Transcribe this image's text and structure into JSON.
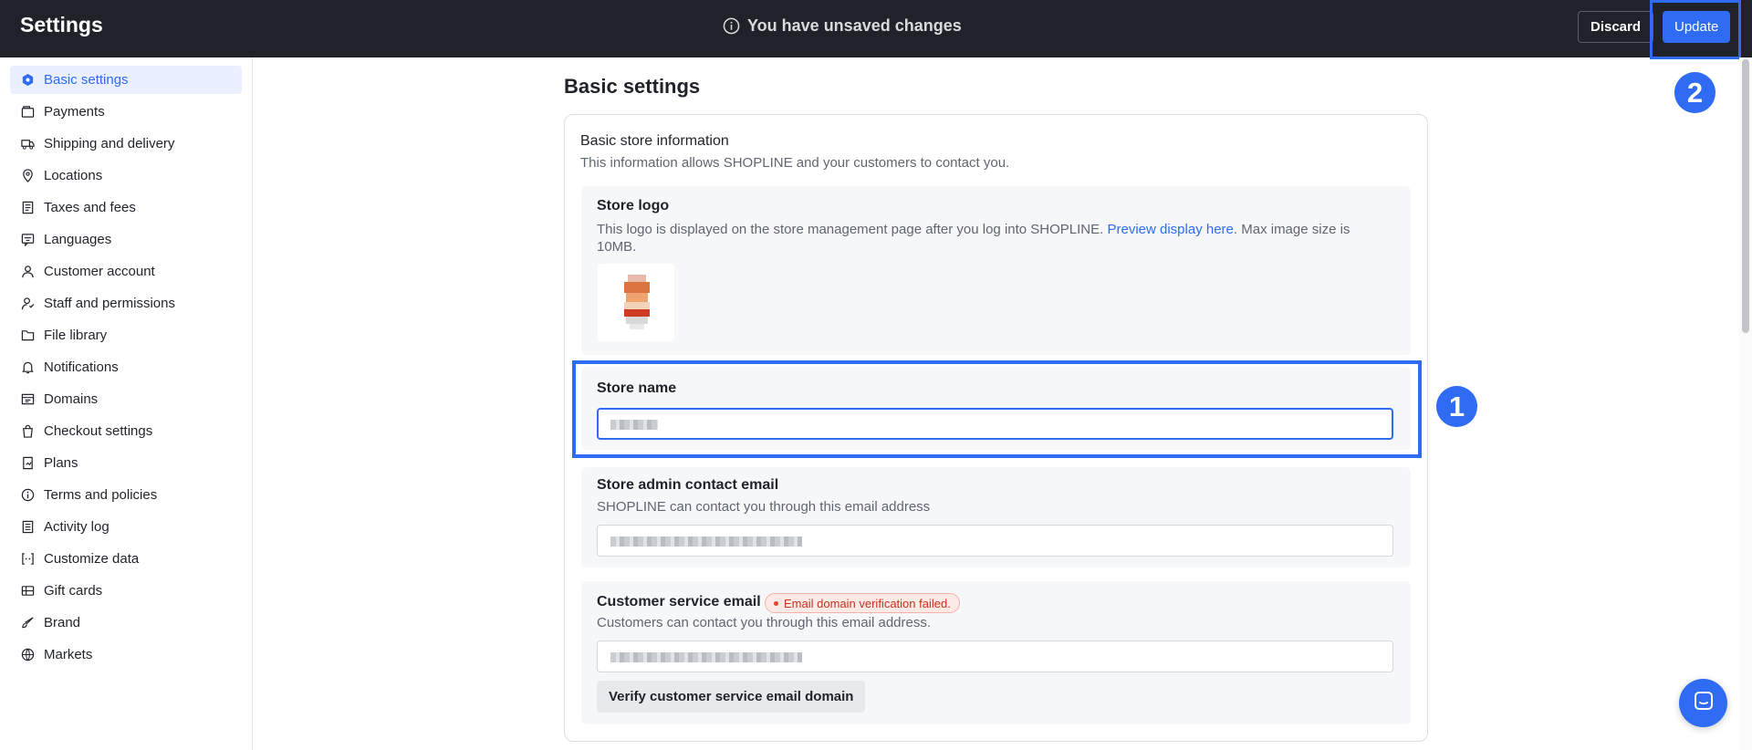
{
  "topbar": {
    "title": "Settings",
    "unsaved_message": "You have unsaved changes",
    "discard_label": "Discard",
    "update_label": "Update"
  },
  "sidebar": {
    "items": [
      {
        "label": "Basic settings",
        "icon": "gear-icon",
        "active": true
      },
      {
        "label": "Payments",
        "icon": "wallet-icon"
      },
      {
        "label": "Shipping and delivery",
        "icon": "truck-icon"
      },
      {
        "label": "Locations",
        "icon": "location-pin-icon"
      },
      {
        "label": "Taxes and fees",
        "icon": "receipt-icon"
      },
      {
        "label": "Languages",
        "icon": "translate-icon"
      },
      {
        "label": "Customer account",
        "icon": "user-icon"
      },
      {
        "label": "Staff and permissions",
        "icon": "staff-icon"
      },
      {
        "label": "File library",
        "icon": "folder-icon"
      },
      {
        "label": "Notifications",
        "icon": "bell-icon"
      },
      {
        "label": "Domains",
        "icon": "domain-icon"
      },
      {
        "label": "Checkout settings",
        "icon": "shopping-bag-icon"
      },
      {
        "label": "Plans",
        "icon": "plan-icon"
      },
      {
        "label": "Terms and policies",
        "icon": "info-icon"
      },
      {
        "label": "Activity log",
        "icon": "log-icon"
      },
      {
        "label": "Customize data",
        "icon": "code-icon"
      },
      {
        "label": "Gift cards",
        "icon": "gift-card-icon"
      },
      {
        "label": "Brand",
        "icon": "brush-icon"
      },
      {
        "label": "Markets",
        "icon": "globe-icon"
      }
    ]
  },
  "main": {
    "page_title": "Basic settings",
    "card": {
      "title": "Basic store information",
      "description": "This information allows SHOPLINE and your customers to contact you.",
      "store_logo": {
        "label": "Store logo",
        "desc_before": "This logo is displayed on the store management page after you log into SHOPLINE. ",
        "desc_link": "Preview display here",
        "desc_after": ". Max image size is 10MB."
      },
      "store_name": {
        "label": "Store name"
      },
      "admin_email": {
        "label": "Store admin contact email",
        "description": "SHOPLINE can contact you through this email address"
      },
      "customer_service_email": {
        "label": "Customer service email",
        "badge": "Email domain verification failed.",
        "description": "Customers can contact you through this email address.",
        "verify_button": "Verify customer service email domain"
      }
    }
  },
  "annotations": {
    "marker_1": "1",
    "marker_2": "2"
  },
  "colors": {
    "accent": "#2f6bf3",
    "topbar_bg": "#1f2329",
    "error": "#c6331f"
  }
}
